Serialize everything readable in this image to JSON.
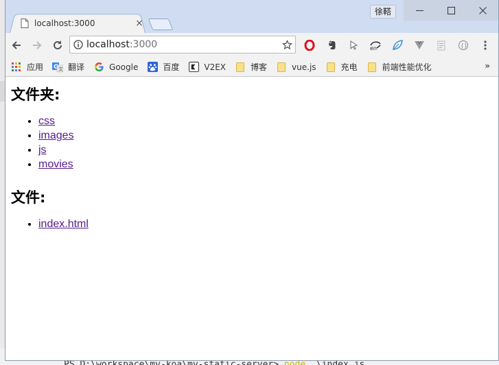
{
  "window": {
    "profile_name": "徐鞳",
    "controls": {
      "minimize": "—",
      "maximize": "☐",
      "close": "✕"
    }
  },
  "tab": {
    "title": "localhost:3000",
    "close": "×"
  },
  "toolbar": {
    "url_host": "localhost",
    "url_port": ":3000",
    "extensions": [
      "opera-icon",
      "evernote-icon",
      "cursor-icon",
      "enoji-icon",
      "leaf-icon",
      "vue-devtools-icon",
      "clipboard-icon",
      "json-icon",
      "menu-icon"
    ]
  },
  "bookmarks": {
    "items": [
      {
        "label": "应用",
        "icon": "apps-grid-icon"
      },
      {
        "label": "翻译",
        "icon": "translate-icon"
      },
      {
        "label": "Google",
        "icon": "google-icon"
      },
      {
        "label": "百度",
        "icon": "baidu-icon"
      },
      {
        "label": "V2EX",
        "icon": "v2ex-icon"
      },
      {
        "label": "博客",
        "icon": "folder-icon"
      },
      {
        "label": "vue.js",
        "icon": "folder-icon"
      },
      {
        "label": "充电",
        "icon": "folder-icon"
      },
      {
        "label": "前端性能优化",
        "icon": "folder-icon"
      }
    ],
    "more": "»"
  },
  "page": {
    "folders_heading": "文件夹:",
    "folders": [
      "css",
      "images",
      "js",
      "movies"
    ],
    "files_heading": "文件:",
    "files": [
      "index.html"
    ]
  },
  "terminal": {
    "prefix": "PS D:\\workspace\\my-koa\\my-static-server> ",
    "cmd": "node",
    "args": " .\\index.js"
  },
  "colors": {
    "link_visited": "#551a8b",
    "titlebar": "#cfdcf1",
    "toolbar": "#f2f2f2"
  }
}
